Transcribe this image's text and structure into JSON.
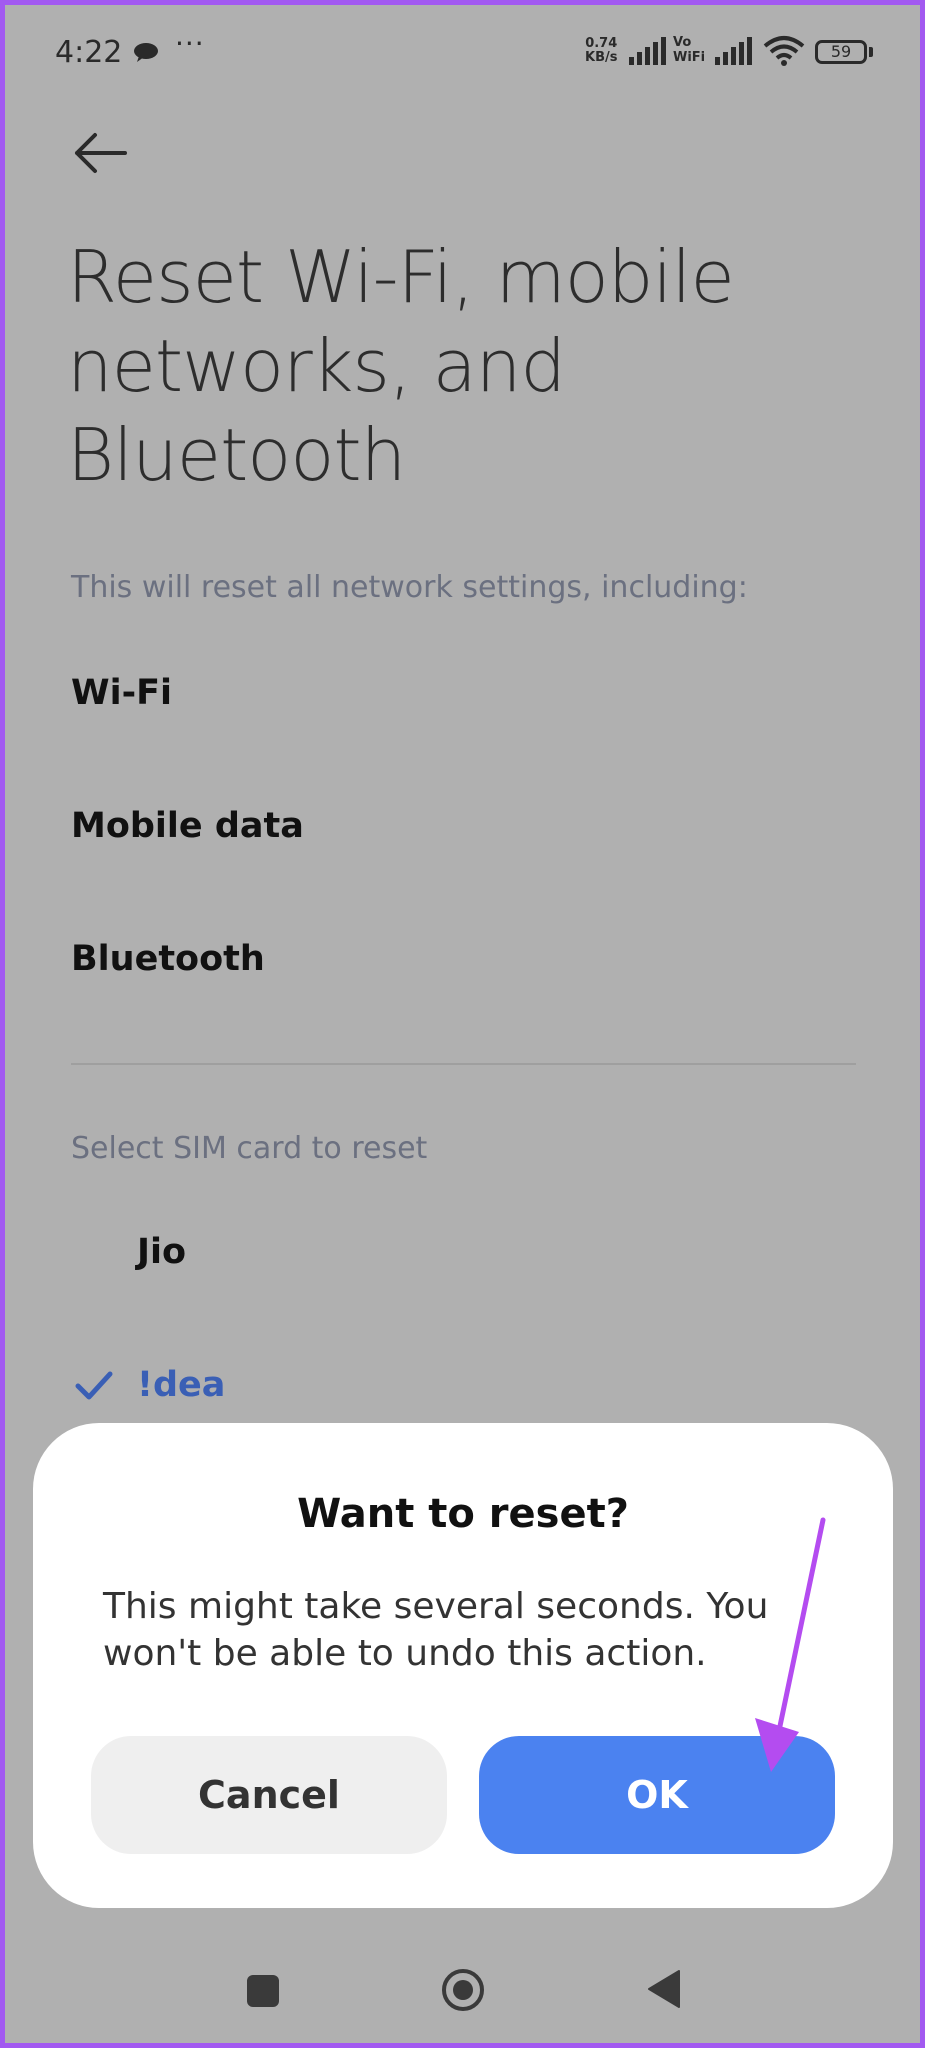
{
  "status_bar": {
    "time": "4:22",
    "more": "···",
    "net_speed_value": "0.74",
    "net_speed_unit": "KB/s",
    "vo": "Vo",
    "wifi_label": "WiFi",
    "battery": "59"
  },
  "page": {
    "title": "Reset Wi-Fi, mobile networks, and Bluetooth",
    "subtitle": "This will reset all network settings, including:",
    "items": [
      "Wi-Fi",
      "Mobile data",
      "Bluetooth"
    ],
    "sim_label": "Select SIM card to reset",
    "sims": [
      {
        "name": "Jio",
        "selected": false
      },
      {
        "name": "!dea",
        "selected": true
      }
    ]
  },
  "dialog": {
    "title": "Want to reset?",
    "message": "This might take several seconds. You won't be able to undo this action.",
    "cancel_label": "Cancel",
    "ok_label": "OK"
  },
  "colors": {
    "accent": "#4b82f0",
    "selected_text": "#3a5fb5",
    "annotation_arrow": "#b44cf0",
    "border": "#a259f0"
  }
}
